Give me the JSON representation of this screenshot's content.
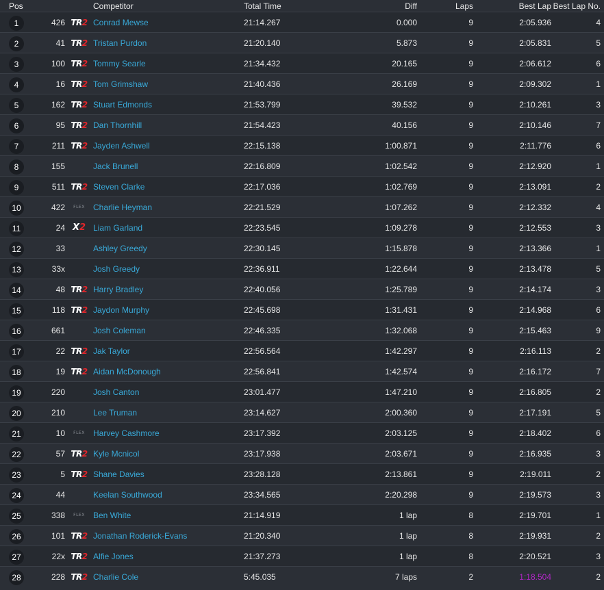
{
  "headers": {
    "pos": "Pos",
    "competitor": "Competitor",
    "total_time": "Total Time",
    "diff": "Diff",
    "laps": "Laps",
    "best_lap": "Best Lap",
    "best_lap_no": "Best Lap No."
  },
  "colors": {
    "link": "#39a9d8",
    "fastest_lap": "#b327c8",
    "logo_red": "#e0262b"
  },
  "rows": [
    {
      "pos": "1",
      "num": "426",
      "logo": "tr2",
      "name": "Conrad Mewse",
      "total": "21:14.267",
      "diff": "0.000",
      "laps": "9",
      "best": "2:05.936",
      "bestno": "4"
    },
    {
      "pos": "2",
      "num": "41",
      "logo": "tr2",
      "name": "Tristan Purdon",
      "total": "21:20.140",
      "diff": "5.873",
      "laps": "9",
      "best": "2:05.831",
      "bestno": "5"
    },
    {
      "pos": "3",
      "num": "100",
      "logo": "tr2",
      "name": "Tommy Searle",
      "total": "21:34.432",
      "diff": "20.165",
      "laps": "9",
      "best": "2:06.612",
      "bestno": "6"
    },
    {
      "pos": "4",
      "num": "16",
      "logo": "tr2",
      "name": "Tom Grimshaw",
      "total": "21:40.436",
      "diff": "26.169",
      "laps": "9",
      "best": "2:09.302",
      "bestno": "1"
    },
    {
      "pos": "5",
      "num": "162",
      "logo": "tr2",
      "name": "Stuart Edmonds",
      "total": "21:53.799",
      "diff": "39.532",
      "laps": "9",
      "best": "2:10.261",
      "bestno": "3"
    },
    {
      "pos": "6",
      "num": "95",
      "logo": "tr2",
      "name": "Dan Thornhill",
      "total": "21:54.423",
      "diff": "40.156",
      "laps": "9",
      "best": "2:10.146",
      "bestno": "7"
    },
    {
      "pos": "7",
      "num": "211",
      "logo": "tr2",
      "name": "Jayden Ashwell",
      "total": "22:15.138",
      "diff": "1:00.871",
      "laps": "9",
      "best": "2:11.776",
      "bestno": "6"
    },
    {
      "pos": "8",
      "num": "155",
      "logo": "",
      "name": "Jack Brunell",
      "total": "22:16.809",
      "diff": "1:02.542",
      "laps": "9",
      "best": "2:12.920",
      "bestno": "1"
    },
    {
      "pos": "9",
      "num": "511",
      "logo": "tr2",
      "name": "Steven Clarke",
      "total": "22:17.036",
      "diff": "1:02.769",
      "laps": "9",
      "best": "2:13.091",
      "bestno": "2"
    },
    {
      "pos": "10",
      "num": "422",
      "logo": "flex",
      "name": "Charlie Heyman",
      "total": "22:21.529",
      "diff": "1:07.262",
      "laps": "9",
      "best": "2:12.332",
      "bestno": "4"
    },
    {
      "pos": "11",
      "num": "24",
      "logo": "x2",
      "name": "Liam Garland",
      "total": "22:23.545",
      "diff": "1:09.278",
      "laps": "9",
      "best": "2:12.553",
      "bestno": "3"
    },
    {
      "pos": "12",
      "num": "33",
      "logo": "",
      "name": "Ashley Greedy",
      "total": "22:30.145",
      "diff": "1:15.878",
      "laps": "9",
      "best": "2:13.366",
      "bestno": "1"
    },
    {
      "pos": "13",
      "num": "33x",
      "logo": "",
      "name": "Josh Greedy",
      "total": "22:36.911",
      "diff": "1:22.644",
      "laps": "9",
      "best": "2:13.478",
      "bestno": "5"
    },
    {
      "pos": "14",
      "num": "48",
      "logo": "tr2",
      "name": "Harry Bradley",
      "total": "22:40.056",
      "diff": "1:25.789",
      "laps": "9",
      "best": "2:14.174",
      "bestno": "3"
    },
    {
      "pos": "15",
      "num": "118",
      "logo": "tr2",
      "name": "Jaydon Murphy",
      "total": "22:45.698",
      "diff": "1:31.431",
      "laps": "9",
      "best": "2:14.968",
      "bestno": "6"
    },
    {
      "pos": "16",
      "num": "661",
      "logo": "",
      "name": "Josh Coleman",
      "total": "22:46.335",
      "diff": "1:32.068",
      "laps": "9",
      "best": "2:15.463",
      "bestno": "9"
    },
    {
      "pos": "17",
      "num": "22",
      "logo": "tr2",
      "name": "Jak Taylor",
      "total": "22:56.564",
      "diff": "1:42.297",
      "laps": "9",
      "best": "2:16.113",
      "bestno": "2"
    },
    {
      "pos": "18",
      "num": "19",
      "logo": "tr2",
      "name": "Aidan McDonough",
      "total": "22:56.841",
      "diff": "1:42.574",
      "laps": "9",
      "best": "2:16.172",
      "bestno": "7"
    },
    {
      "pos": "19",
      "num": "220",
      "logo": "",
      "name": "Josh Canton",
      "total": "23:01.477",
      "diff": "1:47.210",
      "laps": "9",
      "best": "2:16.805",
      "bestno": "2"
    },
    {
      "pos": "20",
      "num": "210",
      "logo": "",
      "name": "Lee Truman",
      "total": "23:14.627",
      "diff": "2:00.360",
      "laps": "9",
      "best": "2:17.191",
      "bestno": "5"
    },
    {
      "pos": "21",
      "num": "10",
      "logo": "flex",
      "name": "Harvey Cashmore",
      "total": "23:17.392",
      "diff": "2:03.125",
      "laps": "9",
      "best": "2:18.402",
      "bestno": "6"
    },
    {
      "pos": "22",
      "num": "57",
      "logo": "tr2",
      "name": "Kyle Mcnicol",
      "total": "23:17.938",
      "diff": "2:03.671",
      "laps": "9",
      "best": "2:16.935",
      "bestno": "3"
    },
    {
      "pos": "23",
      "num": "5",
      "logo": "tr2",
      "name": "Shane Davies",
      "total": "23:28.128",
      "diff": "2:13.861",
      "laps": "9",
      "best": "2:19.011",
      "bestno": "2"
    },
    {
      "pos": "24",
      "num": "44",
      "logo": "",
      "name": "Keelan Southwood",
      "total": "23:34.565",
      "diff": "2:20.298",
      "laps": "9",
      "best": "2:19.573",
      "bestno": "3"
    },
    {
      "pos": "25",
      "num": "338",
      "logo": "flex",
      "name": "Ben White",
      "total": "21:14.919",
      "diff": "1 lap",
      "laps": "8",
      "best": "2:19.701",
      "bestno": "1"
    },
    {
      "pos": "26",
      "num": "101",
      "logo": "tr2",
      "name": "Jonathan Roderick-Evans",
      "total": "21:20.340",
      "diff": "1 lap",
      "laps": "8",
      "best": "2:19.931",
      "bestno": "2"
    },
    {
      "pos": "27",
      "num": "22x",
      "logo": "tr2",
      "name": "Alfie Jones",
      "total": "21:37.273",
      "diff": "1 lap",
      "laps": "8",
      "best": "2:20.521",
      "bestno": "3"
    },
    {
      "pos": "28",
      "num": "228",
      "logo": "tr2",
      "name": "Charlie Cole",
      "total": "5:45.035",
      "diff": "7 laps",
      "laps": "2",
      "best": "1:18.504",
      "bestno": "2",
      "fastest": true
    }
  ],
  "logo_text": {
    "tr2_main": "TR",
    "tr2_num": "2",
    "x2_main": "X",
    "x2_num": "2",
    "flex": "FLEX"
  }
}
